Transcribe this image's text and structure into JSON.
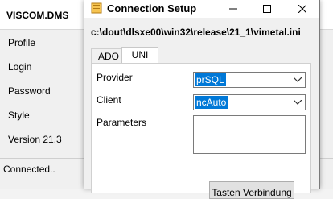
{
  "background_app": {
    "title": "VISCOM.DMS",
    "menu": [
      "Profile",
      "Login",
      "Password",
      "Style",
      "Version 21.3"
    ],
    "status": "Connected.."
  },
  "dialog": {
    "title": "Connection Setup",
    "path": "c:\\dout\\dlsxe00\\win32\\release\\21_1\\vimetal.ini",
    "tabs": [
      "ADO",
      "UNI"
    ],
    "active_tab": "UNI",
    "fields": {
      "provider_label": "Provider",
      "provider_value": "prSQL",
      "client_label": "Client",
      "client_value": "ncAuto",
      "parameters_label": "Parameters",
      "parameters_value": ""
    },
    "bottom_button_label": "Tasten Verbindung"
  },
  "icons": {
    "minimize": "minimize-icon",
    "maximize": "maximize-icon",
    "close": "close-icon",
    "dropdown": "chevron-down-icon",
    "app": "app-icon"
  },
  "colors": {
    "selection": "#0078d7",
    "dialog_bg": "#f0f0f0",
    "panel_bg": "#ffffff"
  }
}
